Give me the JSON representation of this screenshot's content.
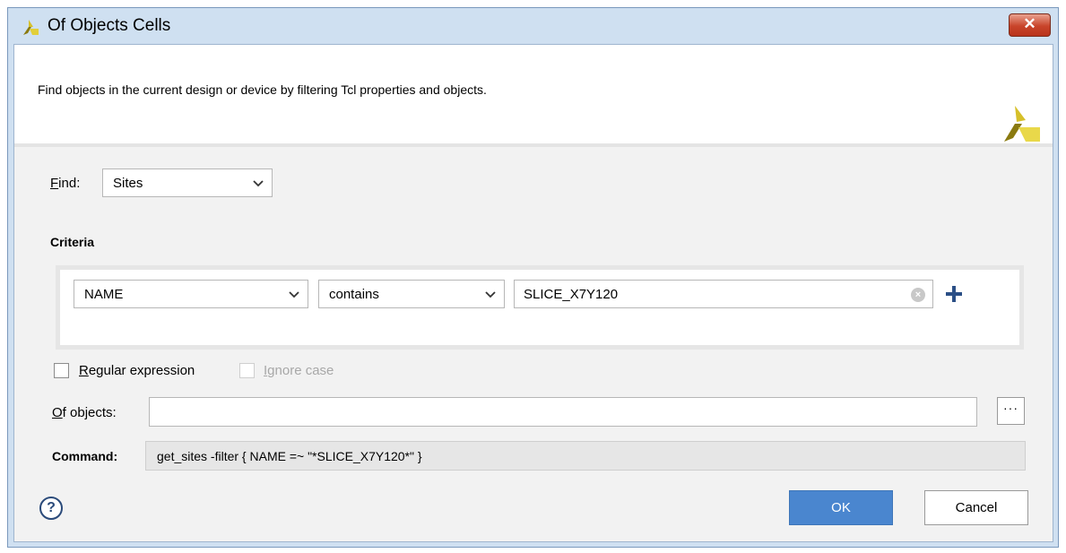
{
  "window": {
    "title": "Of Objects Cells",
    "close_label": "✕"
  },
  "banner": {
    "description": "Find objects in the current design or device by filtering Tcl properties and objects."
  },
  "find": {
    "label_mnemonic": "F",
    "label_rest": "ind:",
    "value": "Sites"
  },
  "criteria": {
    "heading": "Criteria",
    "property": "NAME",
    "operator": "contains",
    "value": "SLICE_X7Y120"
  },
  "options": {
    "regex_mnemonic": "R",
    "regex_rest": "egular expression",
    "regex_checked": false,
    "ignore_case_mnemonic": "I",
    "ignore_case_rest": "gnore case",
    "ignore_case_checked": false,
    "ignore_case_disabled": true
  },
  "of_objects": {
    "label_mnemonic": "O",
    "label_rest": "f objects:",
    "value": "",
    "browse_label": "···"
  },
  "command": {
    "label": "Command:",
    "value": "get_sites -filter { NAME =~  \"*SLICE_X7Y120*\" }"
  },
  "buttons": {
    "help": "?",
    "ok": "OK",
    "cancel": "Cancel"
  },
  "colors": {
    "accent": "#4a86cf",
    "logo": "#c9b21d",
    "logo_dark": "#8a7a10"
  }
}
